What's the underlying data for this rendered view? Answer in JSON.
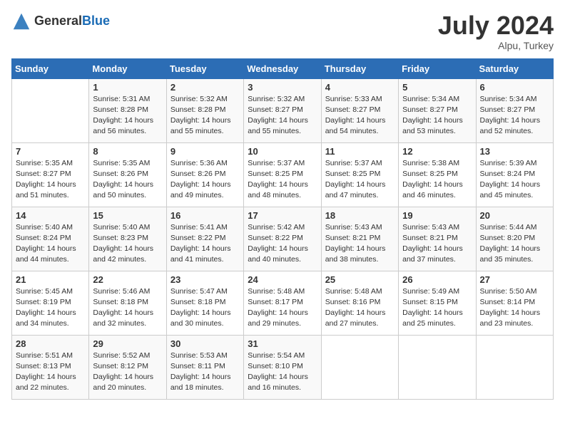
{
  "header": {
    "logo_general": "General",
    "logo_blue": "Blue",
    "month": "July 2024",
    "location": "Alpu, Turkey"
  },
  "days_of_week": [
    "Sunday",
    "Monday",
    "Tuesday",
    "Wednesday",
    "Thursday",
    "Friday",
    "Saturday"
  ],
  "weeks": [
    [
      {
        "day": "",
        "sunrise": "",
        "sunset": "",
        "daylight": ""
      },
      {
        "day": "1",
        "sunrise": "Sunrise: 5:31 AM",
        "sunset": "Sunset: 8:28 PM",
        "daylight": "Daylight: 14 hours and 56 minutes."
      },
      {
        "day": "2",
        "sunrise": "Sunrise: 5:32 AM",
        "sunset": "Sunset: 8:28 PM",
        "daylight": "Daylight: 14 hours and 55 minutes."
      },
      {
        "day": "3",
        "sunrise": "Sunrise: 5:32 AM",
        "sunset": "Sunset: 8:27 PM",
        "daylight": "Daylight: 14 hours and 55 minutes."
      },
      {
        "day": "4",
        "sunrise": "Sunrise: 5:33 AM",
        "sunset": "Sunset: 8:27 PM",
        "daylight": "Daylight: 14 hours and 54 minutes."
      },
      {
        "day": "5",
        "sunrise": "Sunrise: 5:34 AM",
        "sunset": "Sunset: 8:27 PM",
        "daylight": "Daylight: 14 hours and 53 minutes."
      },
      {
        "day": "6",
        "sunrise": "Sunrise: 5:34 AM",
        "sunset": "Sunset: 8:27 PM",
        "daylight": "Daylight: 14 hours and 52 minutes."
      }
    ],
    [
      {
        "day": "7",
        "sunrise": "Sunrise: 5:35 AM",
        "sunset": "Sunset: 8:27 PM",
        "daylight": "Daylight: 14 hours and 51 minutes."
      },
      {
        "day": "8",
        "sunrise": "Sunrise: 5:35 AM",
        "sunset": "Sunset: 8:26 PM",
        "daylight": "Daylight: 14 hours and 50 minutes."
      },
      {
        "day": "9",
        "sunrise": "Sunrise: 5:36 AM",
        "sunset": "Sunset: 8:26 PM",
        "daylight": "Daylight: 14 hours and 49 minutes."
      },
      {
        "day": "10",
        "sunrise": "Sunrise: 5:37 AM",
        "sunset": "Sunset: 8:25 PM",
        "daylight": "Daylight: 14 hours and 48 minutes."
      },
      {
        "day": "11",
        "sunrise": "Sunrise: 5:37 AM",
        "sunset": "Sunset: 8:25 PM",
        "daylight": "Daylight: 14 hours and 47 minutes."
      },
      {
        "day": "12",
        "sunrise": "Sunrise: 5:38 AM",
        "sunset": "Sunset: 8:25 PM",
        "daylight": "Daylight: 14 hours and 46 minutes."
      },
      {
        "day": "13",
        "sunrise": "Sunrise: 5:39 AM",
        "sunset": "Sunset: 8:24 PM",
        "daylight": "Daylight: 14 hours and 45 minutes."
      }
    ],
    [
      {
        "day": "14",
        "sunrise": "Sunrise: 5:40 AM",
        "sunset": "Sunset: 8:24 PM",
        "daylight": "Daylight: 14 hours and 44 minutes."
      },
      {
        "day": "15",
        "sunrise": "Sunrise: 5:40 AM",
        "sunset": "Sunset: 8:23 PM",
        "daylight": "Daylight: 14 hours and 42 minutes."
      },
      {
        "day": "16",
        "sunrise": "Sunrise: 5:41 AM",
        "sunset": "Sunset: 8:22 PM",
        "daylight": "Daylight: 14 hours and 41 minutes."
      },
      {
        "day": "17",
        "sunrise": "Sunrise: 5:42 AM",
        "sunset": "Sunset: 8:22 PM",
        "daylight": "Daylight: 14 hours and 40 minutes."
      },
      {
        "day": "18",
        "sunrise": "Sunrise: 5:43 AM",
        "sunset": "Sunset: 8:21 PM",
        "daylight": "Daylight: 14 hours and 38 minutes."
      },
      {
        "day": "19",
        "sunrise": "Sunrise: 5:43 AM",
        "sunset": "Sunset: 8:21 PM",
        "daylight": "Daylight: 14 hours and 37 minutes."
      },
      {
        "day": "20",
        "sunrise": "Sunrise: 5:44 AM",
        "sunset": "Sunset: 8:20 PM",
        "daylight": "Daylight: 14 hours and 35 minutes."
      }
    ],
    [
      {
        "day": "21",
        "sunrise": "Sunrise: 5:45 AM",
        "sunset": "Sunset: 8:19 PM",
        "daylight": "Daylight: 14 hours and 34 minutes."
      },
      {
        "day": "22",
        "sunrise": "Sunrise: 5:46 AM",
        "sunset": "Sunset: 8:18 PM",
        "daylight": "Daylight: 14 hours and 32 minutes."
      },
      {
        "day": "23",
        "sunrise": "Sunrise: 5:47 AM",
        "sunset": "Sunset: 8:18 PM",
        "daylight": "Daylight: 14 hours and 30 minutes."
      },
      {
        "day": "24",
        "sunrise": "Sunrise: 5:48 AM",
        "sunset": "Sunset: 8:17 PM",
        "daylight": "Daylight: 14 hours and 29 minutes."
      },
      {
        "day": "25",
        "sunrise": "Sunrise: 5:48 AM",
        "sunset": "Sunset: 8:16 PM",
        "daylight": "Daylight: 14 hours and 27 minutes."
      },
      {
        "day": "26",
        "sunrise": "Sunrise: 5:49 AM",
        "sunset": "Sunset: 8:15 PM",
        "daylight": "Daylight: 14 hours and 25 minutes."
      },
      {
        "day": "27",
        "sunrise": "Sunrise: 5:50 AM",
        "sunset": "Sunset: 8:14 PM",
        "daylight": "Daylight: 14 hours and 23 minutes."
      }
    ],
    [
      {
        "day": "28",
        "sunrise": "Sunrise: 5:51 AM",
        "sunset": "Sunset: 8:13 PM",
        "daylight": "Daylight: 14 hours and 22 minutes."
      },
      {
        "day": "29",
        "sunrise": "Sunrise: 5:52 AM",
        "sunset": "Sunset: 8:12 PM",
        "daylight": "Daylight: 14 hours and 20 minutes."
      },
      {
        "day": "30",
        "sunrise": "Sunrise: 5:53 AM",
        "sunset": "Sunset: 8:11 PM",
        "daylight": "Daylight: 14 hours and 18 minutes."
      },
      {
        "day": "31",
        "sunrise": "Sunrise: 5:54 AM",
        "sunset": "Sunset: 8:10 PM",
        "daylight": "Daylight: 14 hours and 16 minutes."
      },
      {
        "day": "",
        "sunrise": "",
        "sunset": "",
        "daylight": ""
      },
      {
        "day": "",
        "sunrise": "",
        "sunset": "",
        "daylight": ""
      },
      {
        "day": "",
        "sunrise": "",
        "sunset": "",
        "daylight": ""
      }
    ]
  ]
}
